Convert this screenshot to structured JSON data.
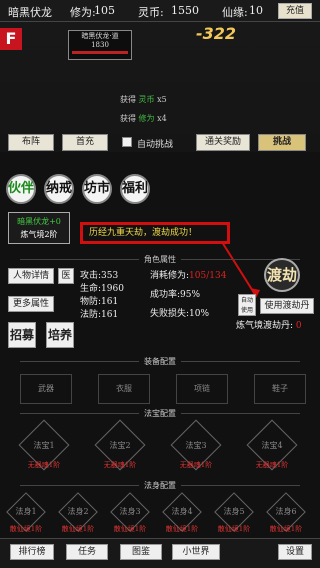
{
  "topbar": {
    "player_name": "暗黑伏龙",
    "cultivation_label": "修为:",
    "cultivation": "105",
    "spirit_label": "灵币:",
    "spirit": "1550",
    "jade_label": "仙缘:",
    "jade": "10",
    "recharge": "充值"
  },
  "battle": {
    "enemy_name": "暗黑伏龙·道",
    "enemy_hp": "1830",
    "enemy_sub": "1830",
    "damage": "-322",
    "loot": [
      {
        "prefix": "获得",
        "item": "灵币",
        "count": "x5"
      },
      {
        "prefix": "获得",
        "item": "修为",
        "count": "x4"
      }
    ]
  },
  "actions": {
    "formation": "布阵",
    "first_charge": "首充",
    "auto_label": "自动挑战",
    "clear_reward": "通关奖励",
    "challenge": "挑战"
  },
  "circles": [
    "伙伴",
    "纳戒",
    "坊市",
    "福利"
  ],
  "hero": {
    "title": "暗黑伏龙+0",
    "realm": "炼气境2阶"
  },
  "notice": "历经九重天劫，渡劫成功！",
  "section_attrs": "角色属性",
  "attr_buttons": {
    "detail": "人物详情",
    "more": "更多属性",
    "recruit": "招募",
    "train": "培养",
    "medic": "医"
  },
  "stats_left": [
    {
      "label": "攻击:",
      "value": "353"
    },
    {
      "label": "生命:",
      "value": "1960"
    },
    {
      "label": "物防:",
      "value": "161"
    },
    {
      "label": "法防:",
      "value": "161"
    }
  ],
  "stats_right": {
    "cost_label": "消耗修为:",
    "cost_value": "105/134",
    "success_label": "成功率:",
    "success_value": "95%",
    "fail_label": "失败损失:",
    "fail_value": "10%"
  },
  "dujie": {
    "label": "渡劫",
    "auto": "自动使用",
    "use_pill": "使用渡劫丹",
    "realm": "炼气境渡劫丹:",
    "realm_count": "0"
  },
  "section_equip": "装备配置",
  "equip": [
    "武器",
    "衣服",
    "项链",
    "鞋子"
  ],
  "section_treasure": "法宝配置",
  "treasures": [
    {
      "name": "法宝1",
      "level": "无器魂1阶"
    },
    {
      "name": "法宝2",
      "level": "无器魂1阶"
    },
    {
      "name": "法宝3",
      "level": "无器魂1阶"
    },
    {
      "name": "法宝4",
      "level": "无器魂1阶"
    }
  ],
  "section_body": "法身配置",
  "bodies": [
    {
      "name": "法身1",
      "level": "散仙境1阶"
    },
    {
      "name": "法身2",
      "level": "散仙境1阶"
    },
    {
      "name": "法身3",
      "level": "散仙境1阶"
    },
    {
      "name": "法身4",
      "level": "散仙境1阶"
    },
    {
      "name": "法身5",
      "level": "散仙境1阶"
    },
    {
      "name": "法身6",
      "level": "散仙境1阶"
    }
  ],
  "nav": {
    "rank": "排行榜",
    "tasks": "任务",
    "atlas": "图鉴",
    "world": "小世界",
    "settings": "设置"
  },
  "colors": {
    "highlight": "#d10f0f",
    "gold": "#f3c85a"
  }
}
